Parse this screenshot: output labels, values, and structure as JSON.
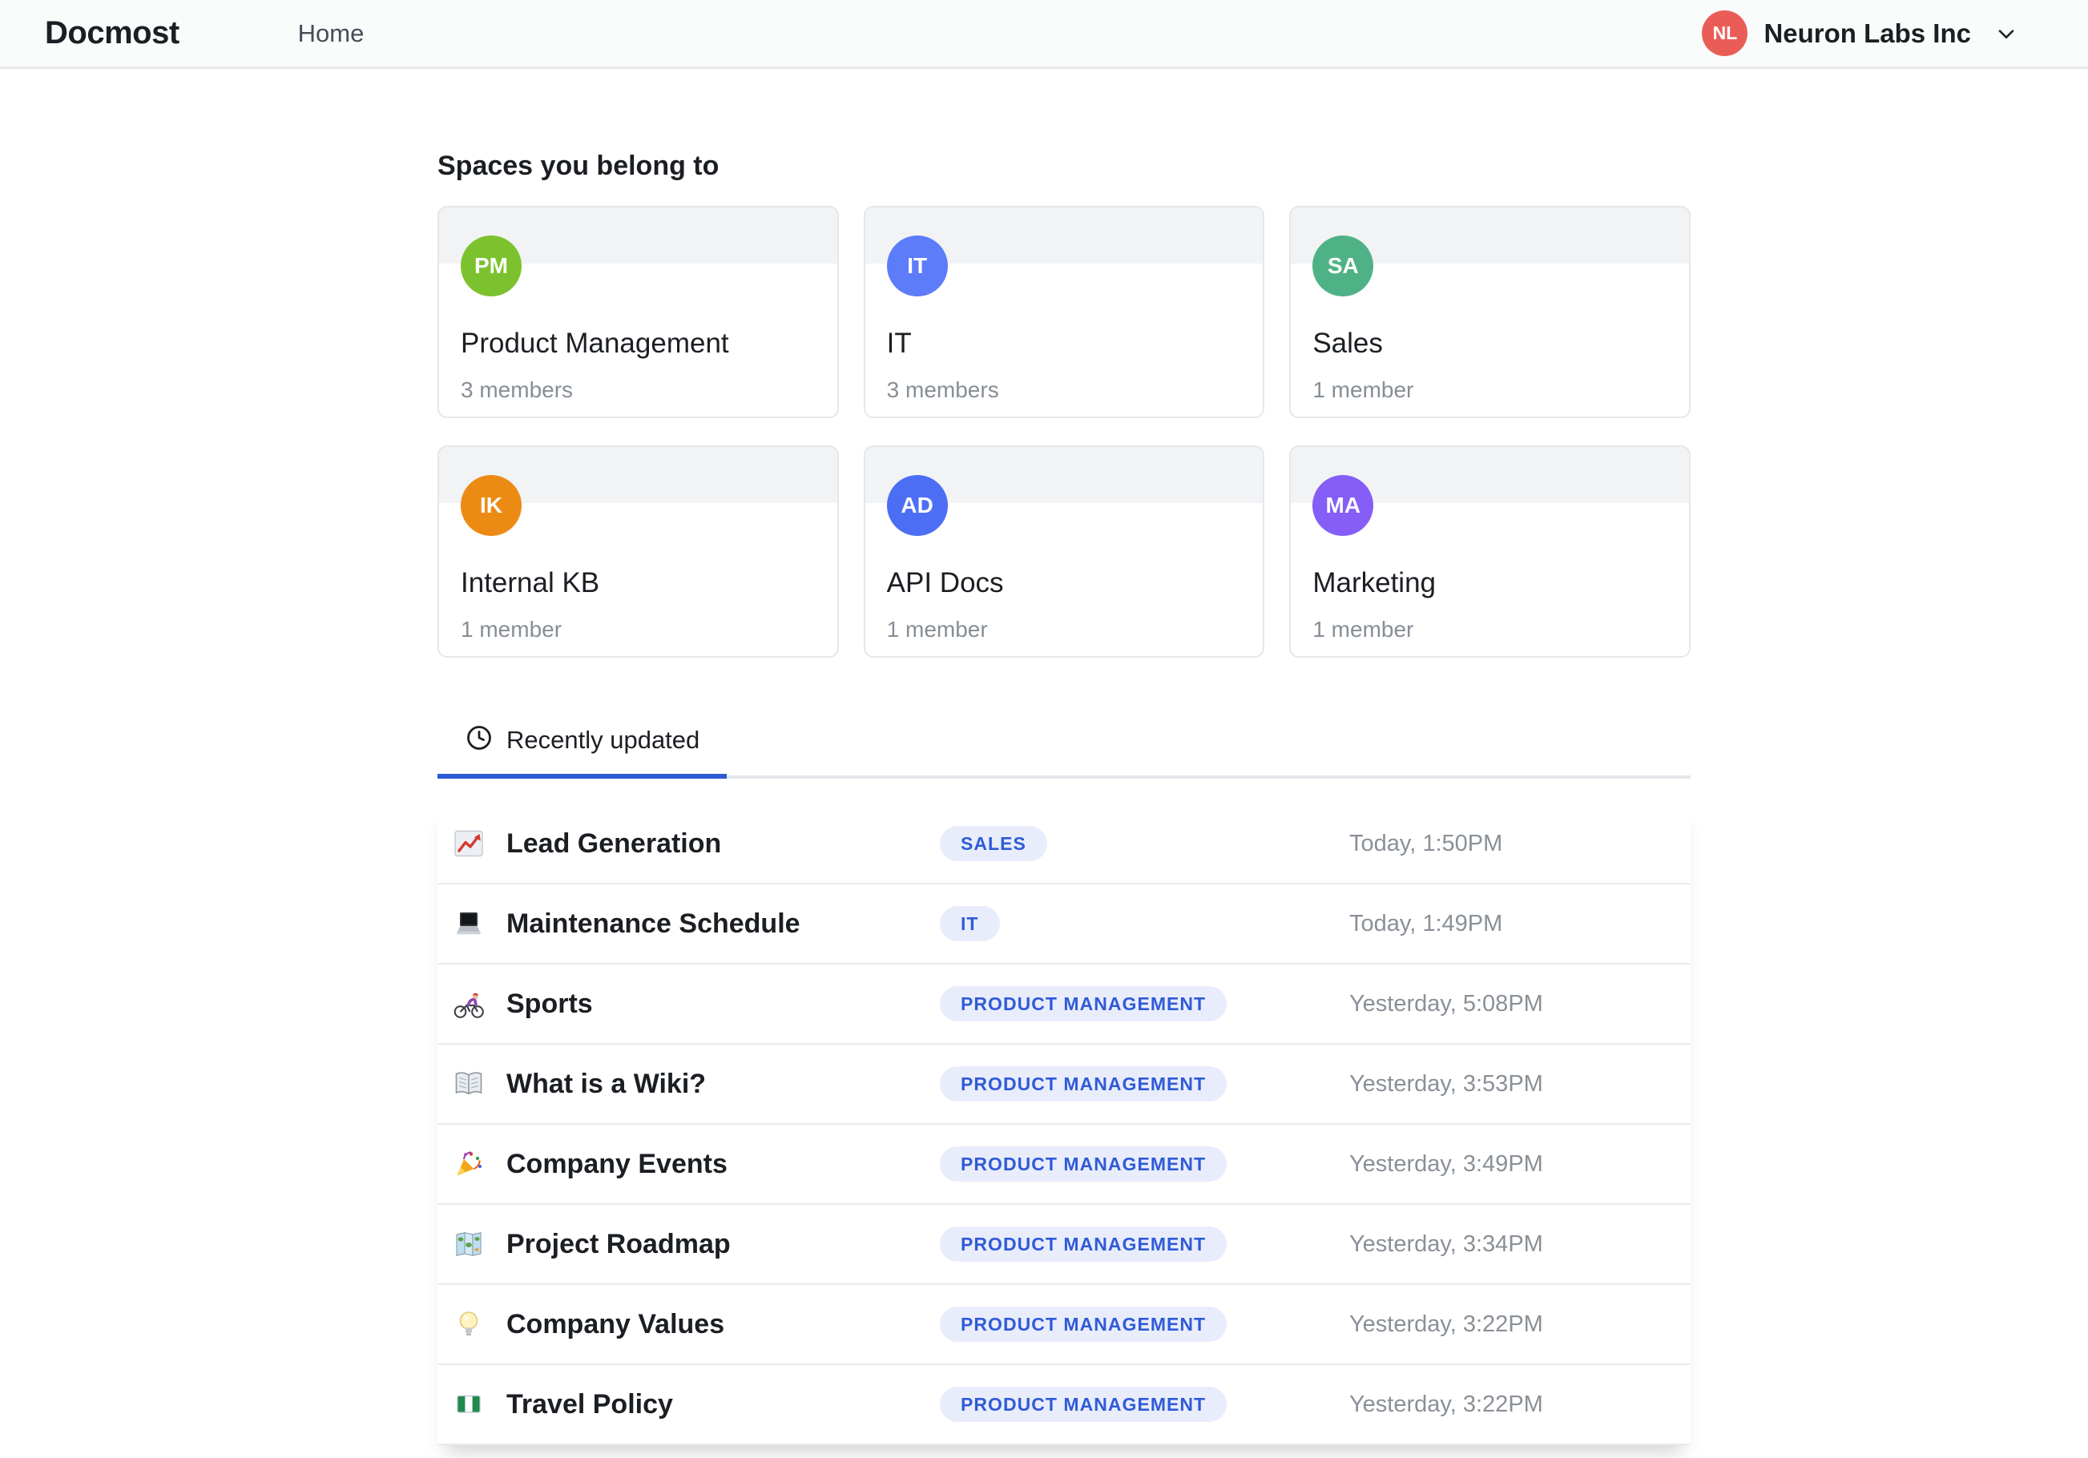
{
  "colors": {
    "accent": "#2d5bd5",
    "badge_bg": "#e9edfb",
    "badge_text": "#2f5bd7",
    "navbar_bg": "#fafbfb"
  },
  "navbar": {
    "logo": "Docmost",
    "home_label": "Home",
    "workspace": {
      "initials": "NL",
      "name": "Neuron Labs Inc",
      "color": "#ea5d57"
    }
  },
  "spaces": {
    "heading": "Spaces you belong to",
    "cards": [
      {
        "initials": "PM",
        "color": "#7cc22e",
        "name": "Product Management",
        "members": "3 members"
      },
      {
        "initials": "IT",
        "color": "#5c7cfa",
        "name": "IT",
        "members": "3 members"
      },
      {
        "initials": "SA",
        "color": "#4fb286",
        "name": "Sales",
        "members": "1 member"
      },
      {
        "initials": "IK",
        "color": "#ec8b13",
        "name": "Internal KB",
        "members": "1 member"
      },
      {
        "initials": "AD",
        "color": "#4c6ef5",
        "name": "API Docs",
        "members": "1 member"
      },
      {
        "initials": "MA",
        "color": "#845ef7",
        "name": "Marketing",
        "members": "1 member"
      }
    ]
  },
  "tabs": {
    "items": [
      {
        "label": "Recently updated",
        "icon": "clock-icon",
        "active": true
      }
    ]
  },
  "recent": {
    "rows": [
      {
        "icon": "chart-increasing-emoji",
        "title": "Lead Generation",
        "space_badge": "SALES",
        "time": "Today, 1:50PM"
      },
      {
        "icon": "laptop-emoji",
        "title": "Maintenance Schedule",
        "space_badge": "IT",
        "time": "Today, 1:49PM"
      },
      {
        "icon": "cyclist-emoji",
        "title": "Sports",
        "space_badge": "PRODUCT MANAGEMENT",
        "time": "Yesterday, 5:08PM"
      },
      {
        "icon": "open-book-emoji",
        "title": "What is a Wiki?",
        "space_badge": "PRODUCT MANAGEMENT",
        "time": "Yesterday, 3:53PM"
      },
      {
        "icon": "party-popper-emoji",
        "title": "Company Events",
        "space_badge": "PRODUCT MANAGEMENT",
        "time": "Yesterday, 3:49PM"
      },
      {
        "icon": "world-map-emoji",
        "title": "Project Roadmap",
        "space_badge": "PRODUCT MANAGEMENT",
        "time": "Yesterday, 3:34PM"
      },
      {
        "icon": "light-bulb-emoji",
        "title": "Company Values",
        "space_badge": "PRODUCT MANAGEMENT",
        "time": "Yesterday, 3:22PM"
      },
      {
        "icon": "nigeria-flag-emoji",
        "title": "Travel Policy",
        "space_badge": "PRODUCT MANAGEMENT",
        "time": "Yesterday, 3:22PM"
      }
    ]
  }
}
